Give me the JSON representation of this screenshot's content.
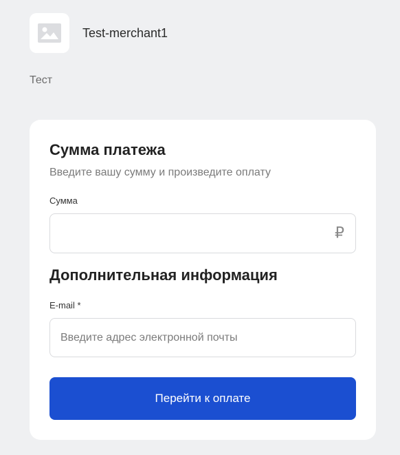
{
  "merchant": {
    "name": "Test-merchant1",
    "description": "Тест",
    "logo_icon": "image-placeholder-icon"
  },
  "payment": {
    "title": "Сумма платежа",
    "subtitle": "Введите вашу сумму и произведите оплату",
    "amount_label": "Сумма",
    "amount_value": "",
    "currency_symbol": "₽"
  },
  "extra": {
    "title": "Дополнительная информация",
    "email_label": "E-mail *",
    "email_placeholder": "Введите адрес электронной почты"
  },
  "submit_label": "Перейти к оплате",
  "colors": {
    "background": "#eff0f2",
    "card": "#ffffff",
    "accent": "#1b4fd1"
  }
}
